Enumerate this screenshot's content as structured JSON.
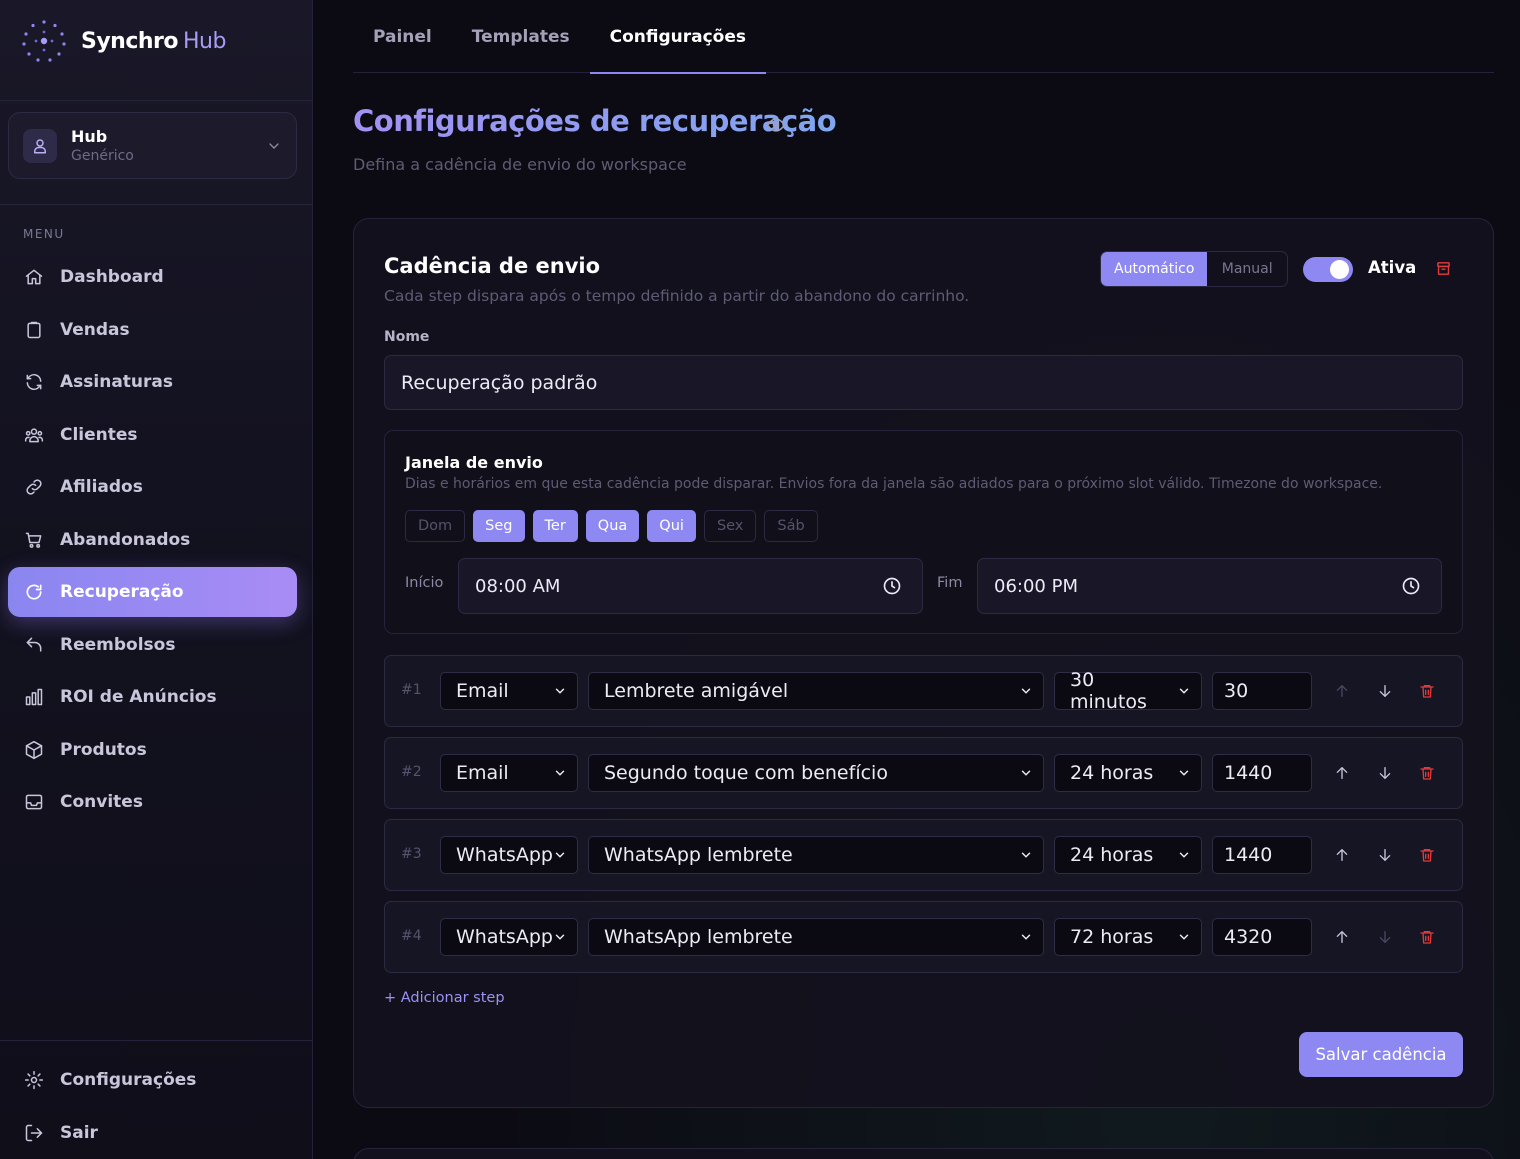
{
  "brand": {
    "name": "Synchro",
    "suffix": "Hub"
  },
  "workspace": {
    "name": "Hub",
    "type": "Genérico"
  },
  "menu": {
    "label": "MENU",
    "items": [
      {
        "label": "Dashboard",
        "icon": "home-icon"
      },
      {
        "label": "Vendas",
        "icon": "clipboard-icon"
      },
      {
        "label": "Assinaturas",
        "icon": "refresh-icon"
      },
      {
        "label": "Clientes",
        "icon": "users-icon"
      },
      {
        "label": "Afiliados",
        "icon": "link-icon"
      },
      {
        "label": "Abandonados",
        "icon": "cart-icon"
      },
      {
        "label": "Recuperação",
        "icon": "recover-icon",
        "active": true
      },
      {
        "label": "Reembolsos",
        "icon": "undo-icon"
      },
      {
        "label": "ROI de Anúncios",
        "icon": "bar-chart-icon"
      },
      {
        "label": "Produtos",
        "icon": "box-icon"
      },
      {
        "label": "Convites",
        "icon": "inbox-icon"
      }
    ],
    "bottom": [
      {
        "label": "Configurações",
        "icon": "gear-icon"
      },
      {
        "label": "Sair",
        "icon": "logout-icon"
      }
    ]
  },
  "tabs": [
    {
      "label": "Painel"
    },
    {
      "label": "Templates"
    },
    {
      "label": "Configurações",
      "active": true
    }
  ],
  "page": {
    "title": "Configurações de recuperação",
    "subtitle": "Defina a cadência de envio do workspace"
  },
  "cadence": {
    "title": "Cadência de envio",
    "subtitle": "Cada step dispara após o tempo definido a partir do abandono do carrinho.",
    "mode_auto": "Automático",
    "mode_manual": "Manual",
    "selected_mode": "Automático",
    "active_label": "Ativa",
    "active": true,
    "name_label": "Nome",
    "name_value": "Recuperação padrão",
    "window": {
      "title": "Janela de envio",
      "description": "Dias e horários em que esta cadência pode disparar. Envios fora da janela são adiados para o próximo slot válido. Timezone do workspace.",
      "days": [
        {
          "label": "Dom",
          "on": false
        },
        {
          "label": "Seg",
          "on": true
        },
        {
          "label": "Ter",
          "on": true
        },
        {
          "label": "Qua",
          "on": true
        },
        {
          "label": "Qui",
          "on": true
        },
        {
          "label": "Sex",
          "on": false
        },
        {
          "label": "Sáb",
          "on": false
        }
      ],
      "start_label": "Início",
      "start_value": "08:00 AM",
      "end_label": "Fim",
      "end_value": "06:00 PM"
    },
    "steps": [
      {
        "num": "#1",
        "channel": "Email",
        "template": "Lembrete amigável",
        "delay": "30 minutos",
        "minutes": "30"
      },
      {
        "num": "#2",
        "channel": "Email",
        "template": "Segundo toque com benefício",
        "delay": "24 horas",
        "minutes": "1440"
      },
      {
        "num": "#3",
        "channel": "WhatsApp",
        "template": "WhatsApp lembrete",
        "delay": "24 horas",
        "minutes": "1440"
      },
      {
        "num": "#4",
        "channel": "WhatsApp",
        "template": "WhatsApp lembrete",
        "delay": "72 horas",
        "minutes": "4320"
      }
    ],
    "add_step": "+ Adicionar step",
    "save": "Salvar cadência"
  },
  "colors": {
    "accent": "#8e88f3",
    "danger": "#e23b3b",
    "background": "#0c0b14"
  }
}
